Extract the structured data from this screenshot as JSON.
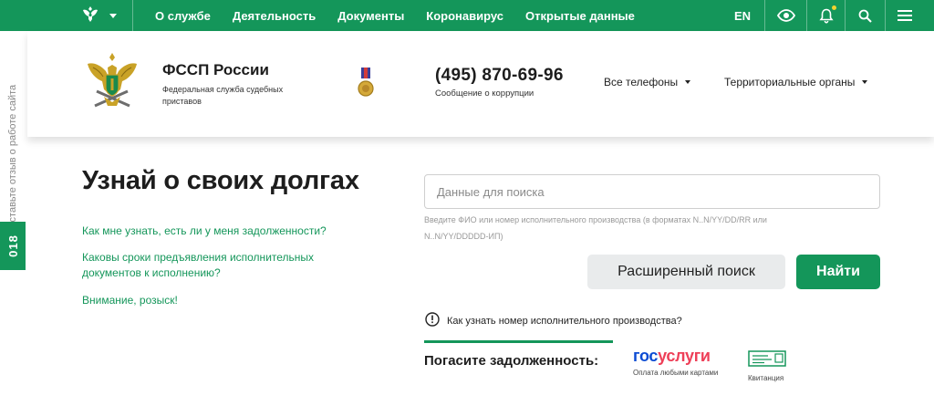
{
  "topnav": {
    "links": [
      "О службе",
      "Деятельность",
      "Документы",
      "Коронавирус",
      "Открытые данные"
    ],
    "lang": "EN"
  },
  "header": {
    "org_title": "ФССП России",
    "org_subtitle": "Федеральная служба судебных приставов",
    "phone": "(495) 870-69-96",
    "phone_subtitle": "Сообщение о коррупции",
    "dropdown_phones": "Все телефоны",
    "dropdown_regions": "Территориальные органы"
  },
  "sidebar": {
    "feedback": "Оставьте отзыв о работе сайта",
    "badge": "018"
  },
  "main": {
    "title": "Узнай о своих долгах",
    "faq": [
      "Как мне узнать, есть ли у меня задолженности?",
      "Каковы сроки предъявления исполнительных документов к исполнению?",
      "Внимание, розыск!"
    ],
    "search": {
      "placeholder": "Данные для поиска",
      "value": "",
      "hint": "Введите ФИО или номер исполнительного производства (в форматах N..N/YY/DD/RR или N..N/YY/DDDDD-ИП)"
    },
    "advanced_button": "Расширенный поиск",
    "find_button": "Найти",
    "howto": "Как узнать номер исполнительного производства?",
    "pay_label": "Погасите задолженность:",
    "gosuslugi": {
      "logo_part1": "гос",
      "logo_part2": "услуги",
      "caption": "Оплата любыми картами"
    },
    "receipt_caption": "Квитанция"
  },
  "colors": {
    "brand_green": "#14965a",
    "gos_blue": "#0d4cd3",
    "gos_red": "#ee3f58"
  }
}
